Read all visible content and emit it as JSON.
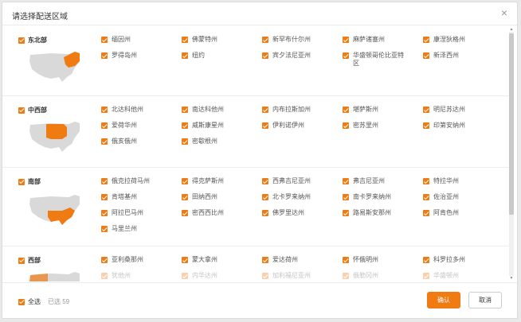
{
  "dialog": {
    "title": "请选择配送区域",
    "close_icon": "close-icon"
  },
  "regions": [
    {
      "name": "东北部",
      "states": [
        "缅因州",
        "佛蒙特州",
        "新罕布什尔州",
        "麻萨诸塞州",
        "康涅狄格州",
        "罗得岛州",
        "纽约",
        "宾夕法尼亚州",
        "华盛顿哥伦比亚特区",
        "新泽西州"
      ]
    },
    {
      "name": "中西部",
      "states": [
        "北达科他州",
        "南达科他州",
        "内布拉斯加州",
        "堪萨斯州",
        "明尼苏达州",
        "爱荷华州",
        "威斯康星州",
        "伊利诺伊州",
        "密苏里州",
        "印第安纳州",
        "俄亥俄州",
        "密歇根州"
      ]
    },
    {
      "name": "南部",
      "states": [
        "俄克拉荷马州",
        "得克萨斯州",
        "西弗吉尼亚州",
        "弗吉尼亚州",
        "特拉华州",
        "肯塔基州",
        "田纳西州",
        "北卡罗来纳州",
        "南卡罗来纳州",
        "佐治亚州",
        "阿拉巴马州",
        "密西西比州",
        "佛罗里达州",
        "路易斯安那州",
        "阿肯色州",
        "马里兰州"
      ]
    },
    {
      "name": "西部",
      "states": [
        "亚利桑那州",
        "蒙大拿州",
        "爱达荷州",
        "怀俄明州",
        "科罗拉多州",
        "犹他州",
        "内华达州",
        "加利福尼亚州",
        "俄勒冈州",
        "华盛顿州"
      ]
    }
  ],
  "footer": {
    "select_all_label": "全选",
    "selected_count": "已选 59",
    "confirm_label": "确认",
    "cancel_label": "取消"
  },
  "colors": {
    "accent": "#f07b12",
    "map_gray": "#d9d9d9"
  }
}
